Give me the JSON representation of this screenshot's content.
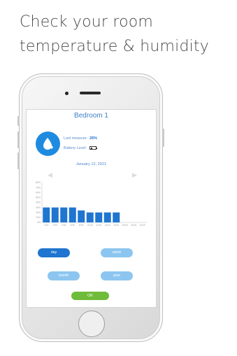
{
  "headline": {
    "line1": "Check your room",
    "line2": "temperature & humidity"
  },
  "screen": {
    "room_name": "Bedroom 1",
    "last_measure_label": "Last measure:",
    "last_measure_value": "26%",
    "battery_label": "Battery Level:",
    "battery_level": 0.3,
    "date": "January 12, 2021",
    "prev_icon": "chevron-left-icon",
    "next_icon": "chevron-right-icon",
    "drop_icon": "water-drop-icon"
  },
  "chart_data": {
    "type": "bar",
    "categories": [
      "0:00",
      "2:00",
      "4:00",
      "6:00",
      "8:00",
      "10:00",
      "12:00",
      "14:00",
      "16:00",
      "18:00",
      "20:00",
      "22:00"
    ],
    "values": [
      30,
      30,
      30,
      30,
      24,
      20,
      20,
      20,
      20,
      0,
      0,
      0
    ],
    "y_ticks": [
      "0%",
      "10%",
      "20%",
      "30%",
      "40%",
      "50%",
      "60%",
      "70%",
      "80%"
    ],
    "ylim": [
      0,
      80
    ],
    "bar_color": "#1f75d0"
  },
  "period_buttons": {
    "day": "day",
    "week": "week",
    "month": "month",
    "year": "year",
    "active": "day"
  },
  "ok_label": "OK",
  "colors": {
    "accent": "#1f75d0",
    "light_accent": "#8cc6f0",
    "ok": "#6fbb3a"
  }
}
